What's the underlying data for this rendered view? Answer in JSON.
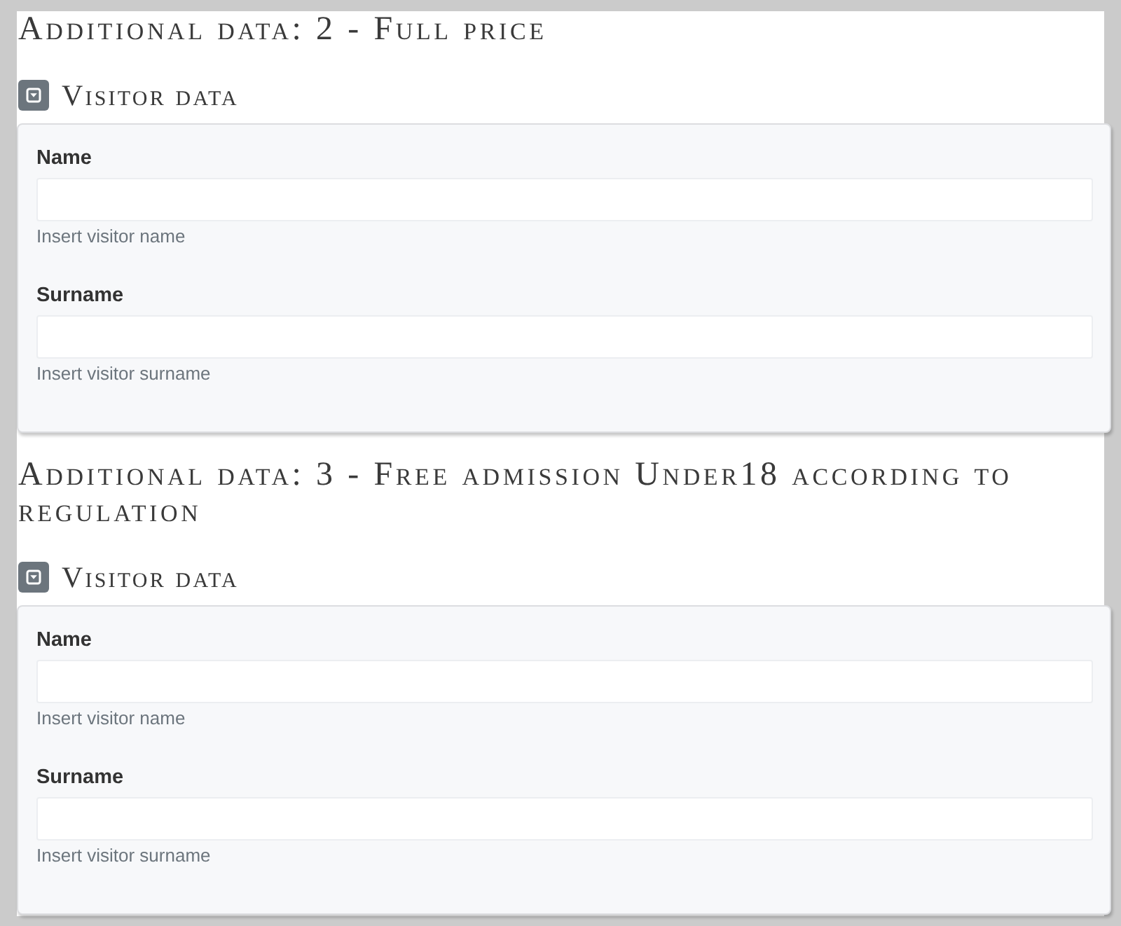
{
  "sections": [
    {
      "title": "Additional data: 2 - Full price",
      "group": {
        "title": "Visitor data",
        "expanded": true,
        "fields": [
          {
            "label": "Name",
            "help": "Insert visitor name"
          },
          {
            "label": "Surname",
            "help": "Insert visitor surname"
          }
        ]
      }
    },
    {
      "title": "Additional data: 3 - Free admission Under18 according to regulation",
      "group": {
        "title": "Visitor data",
        "expanded": true,
        "fields": [
          {
            "label": "Name",
            "help": "Insert visitor name"
          },
          {
            "label": "Surname",
            "help": "Insert visitor surname"
          }
        ]
      }
    }
  ]
}
